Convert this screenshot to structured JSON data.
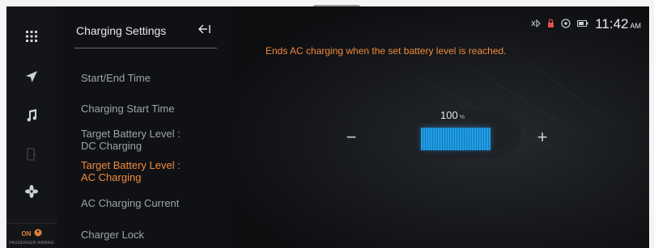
{
  "status_bar": {
    "icons": [
      "bluetooth-audio-icon",
      "passenger-lock-icon",
      "seat-heat-icon",
      "battery-icon"
    ],
    "time": "11:42",
    "ampm": "AM"
  },
  "rail": {
    "icons": [
      "apps-grid-icon",
      "navigation-icon",
      "music-icon",
      "phone-icon",
      "fan-icon"
    ],
    "airbag": {
      "status": "ON",
      "label": "PASSENGER AIRBAG"
    }
  },
  "menu": {
    "title": "Charging Settings",
    "back_icon": "back-arrow-icon",
    "items": [
      {
        "label": "Start/End Time"
      },
      {
        "label": "Charging Start Time"
      },
      {
        "line1": "Target Battery Level :",
        "line2": "DC Charging"
      },
      {
        "line1": "Target Battery Level :",
        "line2": "AC Charging",
        "selected": true
      },
      {
        "label": "AC Charging Current"
      },
      {
        "label": "Charger Lock"
      }
    ]
  },
  "content": {
    "description": "Ends AC charging when the set battery level is reached.",
    "level_value": "100",
    "level_unit": "%",
    "level_fraction": 1.0,
    "minus_symbol": "−",
    "plus_symbol": "+"
  },
  "colors": {
    "accent": "#f08a3c",
    "battery_fill": "#1f9fe2",
    "background": "#0e0f11"
  }
}
